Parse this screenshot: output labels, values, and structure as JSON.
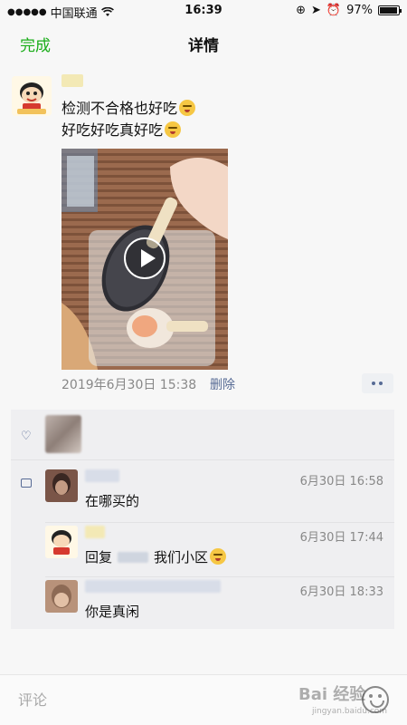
{
  "status_bar": {
    "signal_dots": "●●●●●",
    "carrier": "中国联通",
    "wifi_icon": "wifi-icon",
    "time": "16:39",
    "battery_percent": "97%",
    "battery_level": 0.97
  },
  "nav": {
    "done_label": "完成",
    "title": "详情"
  },
  "post": {
    "line1": "检测不合格也好吃",
    "line2": "好吃好吃真好吃",
    "timestamp": "2019年6月30日 15:38",
    "delete_label": "删除"
  },
  "comments": [
    {
      "time": "6月30日 16:58",
      "text": "在哪买的"
    },
    {
      "time": "6月30日 17:44",
      "reply_prefix": "回复",
      "text": "我们小区"
    },
    {
      "time": "6月30日 18:33",
      "text": "你是真闲"
    }
  ],
  "input": {
    "placeholder": "评论"
  },
  "watermark": {
    "main": "Bai 经验",
    "sub": "jingyan.baidu.com"
  },
  "colors": {
    "accent_green": "#1aad19",
    "link_blue": "#576b95",
    "meta_gray": "#888888"
  }
}
